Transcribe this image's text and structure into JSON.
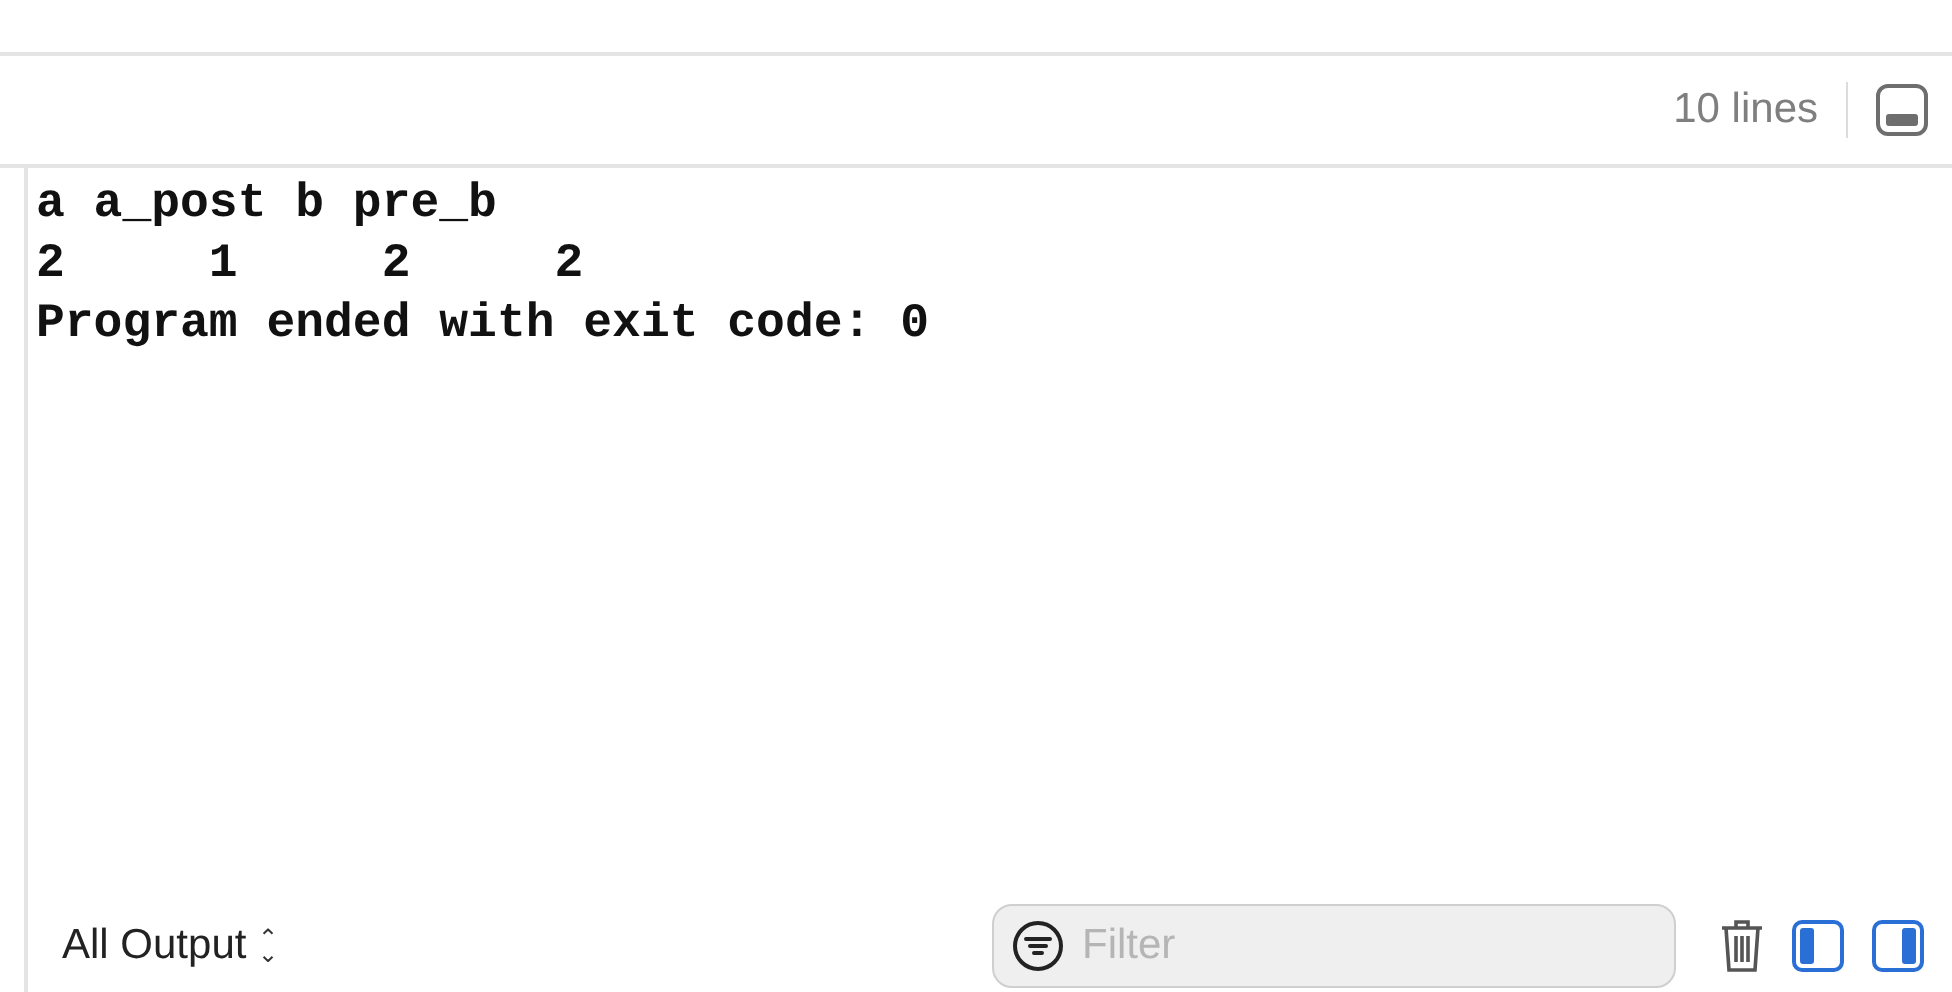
{
  "header": {
    "line_count": "10 lines"
  },
  "output": {
    "lines": [
      "a a_post b pre_b",
      "2     1     2     2",
      "Program ended with exit code: 0"
    ]
  },
  "footer": {
    "scope": "All Output",
    "scope_caret": "⌃⌄",
    "filter": {
      "placeholder": "Filter"
    }
  }
}
